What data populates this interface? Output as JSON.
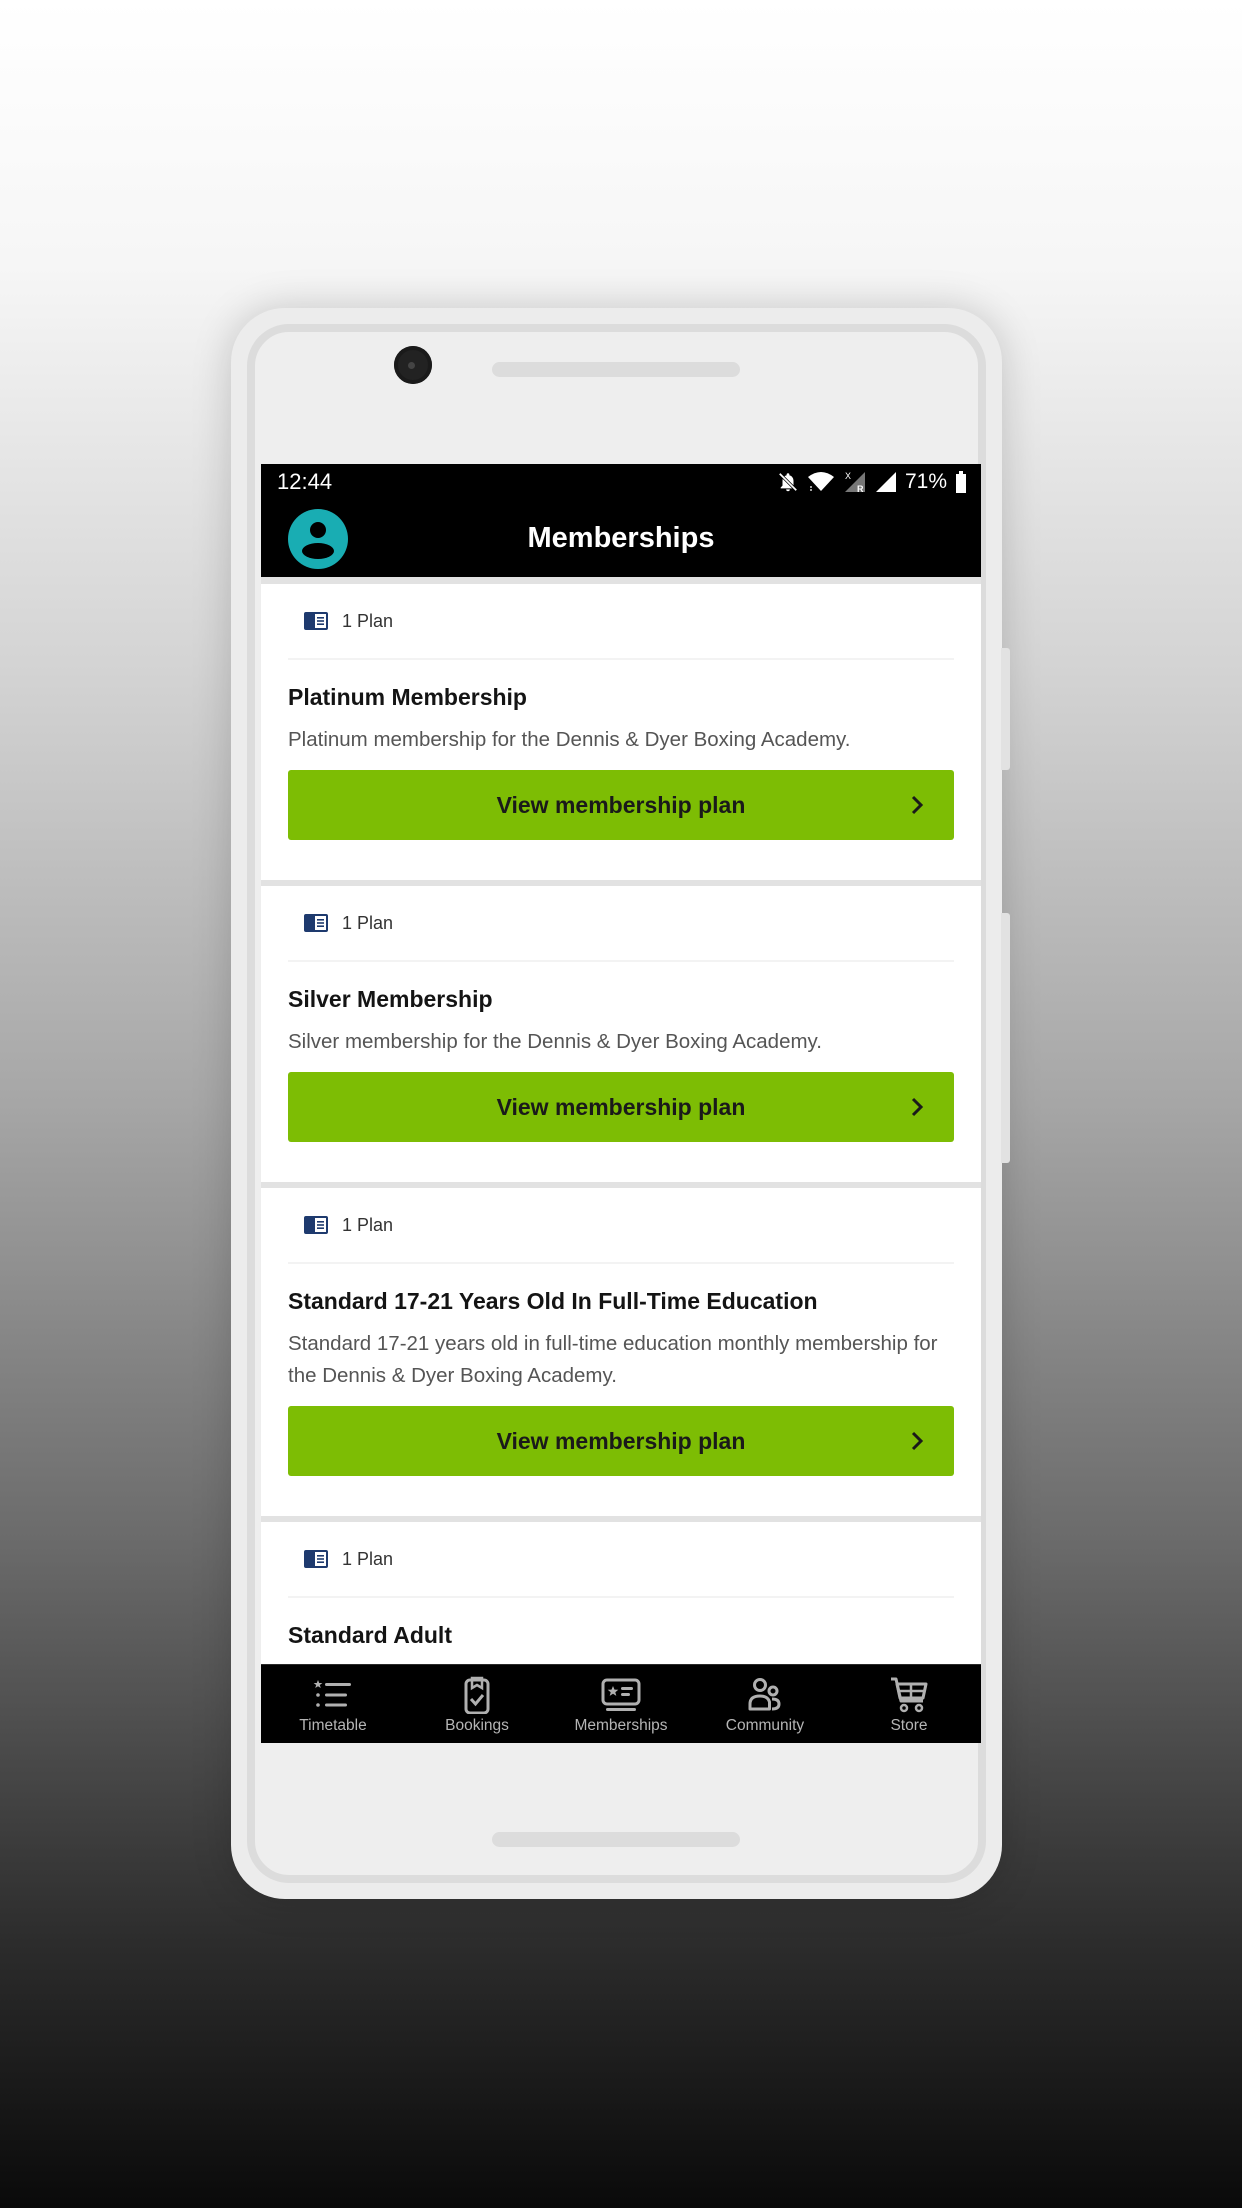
{
  "status_bar": {
    "time": "12:44",
    "battery_percent": "71%",
    "icons": [
      "notifications-muted-icon",
      "wifi-icon",
      "mobile-data-roaming-icon",
      "cell-signal-icon",
      "battery-icon"
    ],
    "roaming_marker": "R",
    "data_off_marker": "X"
  },
  "app_bar": {
    "title": "Memberships",
    "avatar_icon": "account-circle-icon"
  },
  "colors": {
    "accent_button": "#7dbd04",
    "avatar": "#19adb3",
    "plan_icon": "#1e3a6e",
    "bar_background": "#000000"
  },
  "memberships": [
    {
      "plan_count": "1 Plan",
      "title": "Platinum Membership",
      "description": "Platinum membership for the Dennis & Dyer Boxing Academy.",
      "button_label": "View membership plan"
    },
    {
      "plan_count": "1 Plan",
      "title": "Silver Membership",
      "description": "Silver membership for the Dennis & Dyer Boxing Academy.",
      "button_label": "View membership plan"
    },
    {
      "plan_count": "1 Plan",
      "title": "Standard 17-21 Years Old In Full-Time Education",
      "description": "Standard 17-21 years old in full-time education monthly membership for the Dennis & Dyer Boxing Academy.",
      "button_label": "View membership plan"
    },
    {
      "plan_count": "1 Plan",
      "title": "Standard Adult"
    }
  ],
  "bottom_nav": {
    "items": [
      {
        "label": "Timetable",
        "icon": "timetable-list-icon"
      },
      {
        "label": "Bookings",
        "icon": "clipboard-check-icon"
      },
      {
        "label": "Memberships",
        "icon": "membership-card-icon"
      },
      {
        "label": "Community",
        "icon": "community-people-icon"
      },
      {
        "label": "Store",
        "icon": "shopping-cart-icon"
      }
    ]
  }
}
